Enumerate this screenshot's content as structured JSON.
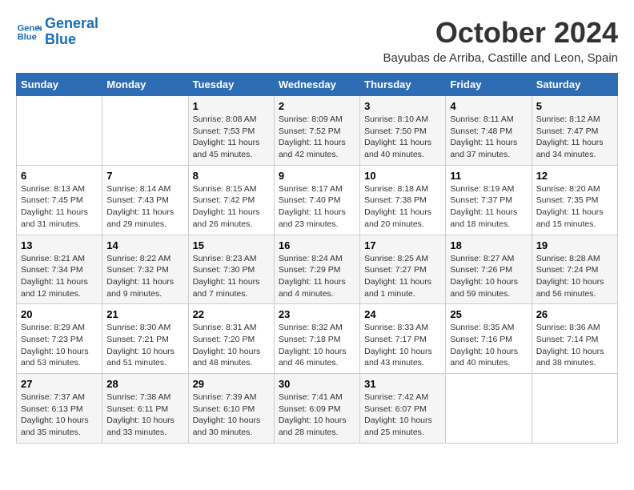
{
  "header": {
    "logo_line1": "General",
    "logo_line2": "Blue",
    "title": "October 2024",
    "subtitle": "Bayubas de Arriba, Castille and Leon, Spain"
  },
  "days_of_week": [
    "Sunday",
    "Monday",
    "Tuesday",
    "Wednesday",
    "Thursday",
    "Friday",
    "Saturday"
  ],
  "weeks": [
    [
      {
        "day": "",
        "content": ""
      },
      {
        "day": "",
        "content": ""
      },
      {
        "day": "1",
        "content": "Sunrise: 8:08 AM\nSunset: 7:53 PM\nDaylight: 11 hours and 45 minutes."
      },
      {
        "day": "2",
        "content": "Sunrise: 8:09 AM\nSunset: 7:52 PM\nDaylight: 11 hours and 42 minutes."
      },
      {
        "day": "3",
        "content": "Sunrise: 8:10 AM\nSunset: 7:50 PM\nDaylight: 11 hours and 40 minutes."
      },
      {
        "day": "4",
        "content": "Sunrise: 8:11 AM\nSunset: 7:48 PM\nDaylight: 11 hours and 37 minutes."
      },
      {
        "day": "5",
        "content": "Sunrise: 8:12 AM\nSunset: 7:47 PM\nDaylight: 11 hours and 34 minutes."
      }
    ],
    [
      {
        "day": "6",
        "content": "Sunrise: 8:13 AM\nSunset: 7:45 PM\nDaylight: 11 hours and 31 minutes."
      },
      {
        "day": "7",
        "content": "Sunrise: 8:14 AM\nSunset: 7:43 PM\nDaylight: 11 hours and 29 minutes."
      },
      {
        "day": "8",
        "content": "Sunrise: 8:15 AM\nSunset: 7:42 PM\nDaylight: 11 hours and 26 minutes."
      },
      {
        "day": "9",
        "content": "Sunrise: 8:17 AM\nSunset: 7:40 PM\nDaylight: 11 hours and 23 minutes."
      },
      {
        "day": "10",
        "content": "Sunrise: 8:18 AM\nSunset: 7:38 PM\nDaylight: 11 hours and 20 minutes."
      },
      {
        "day": "11",
        "content": "Sunrise: 8:19 AM\nSunset: 7:37 PM\nDaylight: 11 hours and 18 minutes."
      },
      {
        "day": "12",
        "content": "Sunrise: 8:20 AM\nSunset: 7:35 PM\nDaylight: 11 hours and 15 minutes."
      }
    ],
    [
      {
        "day": "13",
        "content": "Sunrise: 8:21 AM\nSunset: 7:34 PM\nDaylight: 11 hours and 12 minutes."
      },
      {
        "day": "14",
        "content": "Sunrise: 8:22 AM\nSunset: 7:32 PM\nDaylight: 11 hours and 9 minutes."
      },
      {
        "day": "15",
        "content": "Sunrise: 8:23 AM\nSunset: 7:30 PM\nDaylight: 11 hours and 7 minutes."
      },
      {
        "day": "16",
        "content": "Sunrise: 8:24 AM\nSunset: 7:29 PM\nDaylight: 11 hours and 4 minutes."
      },
      {
        "day": "17",
        "content": "Sunrise: 8:25 AM\nSunset: 7:27 PM\nDaylight: 11 hours and 1 minute."
      },
      {
        "day": "18",
        "content": "Sunrise: 8:27 AM\nSunset: 7:26 PM\nDaylight: 10 hours and 59 minutes."
      },
      {
        "day": "19",
        "content": "Sunrise: 8:28 AM\nSunset: 7:24 PM\nDaylight: 10 hours and 56 minutes."
      }
    ],
    [
      {
        "day": "20",
        "content": "Sunrise: 8:29 AM\nSunset: 7:23 PM\nDaylight: 10 hours and 53 minutes."
      },
      {
        "day": "21",
        "content": "Sunrise: 8:30 AM\nSunset: 7:21 PM\nDaylight: 10 hours and 51 minutes."
      },
      {
        "day": "22",
        "content": "Sunrise: 8:31 AM\nSunset: 7:20 PM\nDaylight: 10 hours and 48 minutes."
      },
      {
        "day": "23",
        "content": "Sunrise: 8:32 AM\nSunset: 7:18 PM\nDaylight: 10 hours and 46 minutes."
      },
      {
        "day": "24",
        "content": "Sunrise: 8:33 AM\nSunset: 7:17 PM\nDaylight: 10 hours and 43 minutes."
      },
      {
        "day": "25",
        "content": "Sunrise: 8:35 AM\nSunset: 7:16 PM\nDaylight: 10 hours and 40 minutes."
      },
      {
        "day": "26",
        "content": "Sunrise: 8:36 AM\nSunset: 7:14 PM\nDaylight: 10 hours and 38 minutes."
      }
    ],
    [
      {
        "day": "27",
        "content": "Sunrise: 7:37 AM\nSunset: 6:13 PM\nDaylight: 10 hours and 35 minutes."
      },
      {
        "day": "28",
        "content": "Sunrise: 7:38 AM\nSunset: 6:11 PM\nDaylight: 10 hours and 33 minutes."
      },
      {
        "day": "29",
        "content": "Sunrise: 7:39 AM\nSunset: 6:10 PM\nDaylight: 10 hours and 30 minutes."
      },
      {
        "day": "30",
        "content": "Sunrise: 7:41 AM\nSunset: 6:09 PM\nDaylight: 10 hours and 28 minutes."
      },
      {
        "day": "31",
        "content": "Sunrise: 7:42 AM\nSunset: 6:07 PM\nDaylight: 10 hours and 25 minutes."
      },
      {
        "day": "",
        "content": ""
      },
      {
        "day": "",
        "content": ""
      }
    ]
  ]
}
